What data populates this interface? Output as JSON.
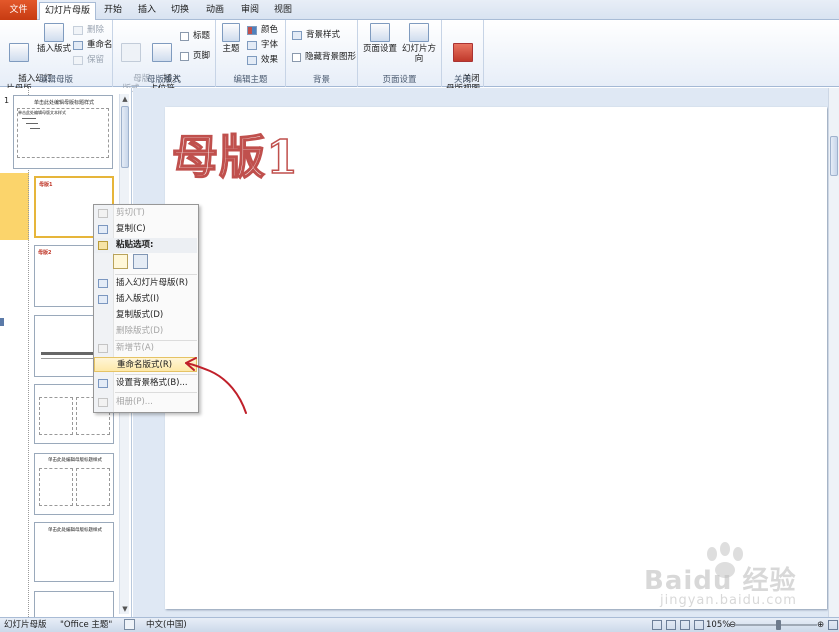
{
  "tabs": {
    "file": "文件",
    "slide_master": "幻灯片母版",
    "home": "开始",
    "insert": "插入",
    "transitions": "切换",
    "animations": "动画",
    "review": "审阅",
    "view": "视图"
  },
  "ribbon": {
    "edit_master": {
      "label": "编辑母版",
      "insert_slide_master": "插入幻灯\n片母版",
      "insert_layout": "插入版式",
      "delete": "删除",
      "rename": "重命名",
      "preserve": "保留"
    },
    "master_layout": {
      "label": "母版版式",
      "master_layout_btn": "母版\n版式",
      "insert_placeholder": "插入\n占位符",
      "title_chk": "标题",
      "footer_chk": "页脚"
    },
    "edit_theme": {
      "label": "编辑主题",
      "themes": "主题",
      "colors": "颜色",
      "fonts": "字体",
      "effects": "效果"
    },
    "background": {
      "label": "背景",
      "bg_styles": "背景样式",
      "hide_bg": "隐藏背景图形"
    },
    "page_setup": {
      "label": "页面设置",
      "page_setup_btn": "页面设置",
      "orientation": "幻灯片方向"
    },
    "close": {
      "label": "关闭",
      "close_master": "关闭\n母版视图"
    }
  },
  "thumbs": {
    "slide_number": "1",
    "master_title": "单击此处编辑母版标题样式",
    "master_body": "单击此处编辑母版文本样式",
    "layout1_title": "母版1",
    "layout2_title": "母版2",
    "layout4_title": "单击此处编辑母版标题样式",
    "layout5_title": "单击此处编辑母版标题样式"
  },
  "slide": {
    "title": "母版1"
  },
  "context_menu": {
    "cut": "剪切(T)",
    "copy": "复制(C)",
    "paste_options": "粘贴选项:",
    "insert_slide_master": "插入幻灯片母版(R)",
    "insert_layout": "插入版式(I)",
    "duplicate_layout": "复制版式(D)",
    "delete_layout": "删除版式(D)",
    "add_section": "新增节(A)",
    "rename_layout": "重命名版式(R)",
    "format_background": "设置背景格式(B)...",
    "photo_album": "相册(P)..."
  },
  "status": {
    "view": "幻灯片母版",
    "theme": "\"Office 主题\"",
    "language": "中文(中国)",
    "zoom": "105%"
  },
  "watermark": {
    "text": "Baidu 经验",
    "url": "jingyan.baidu.com"
  },
  "colors": {
    "file_tab": "#d24726",
    "selection": "#fbd46b",
    "title_outline": "#c0504d",
    "annotation": "#c0202a"
  }
}
